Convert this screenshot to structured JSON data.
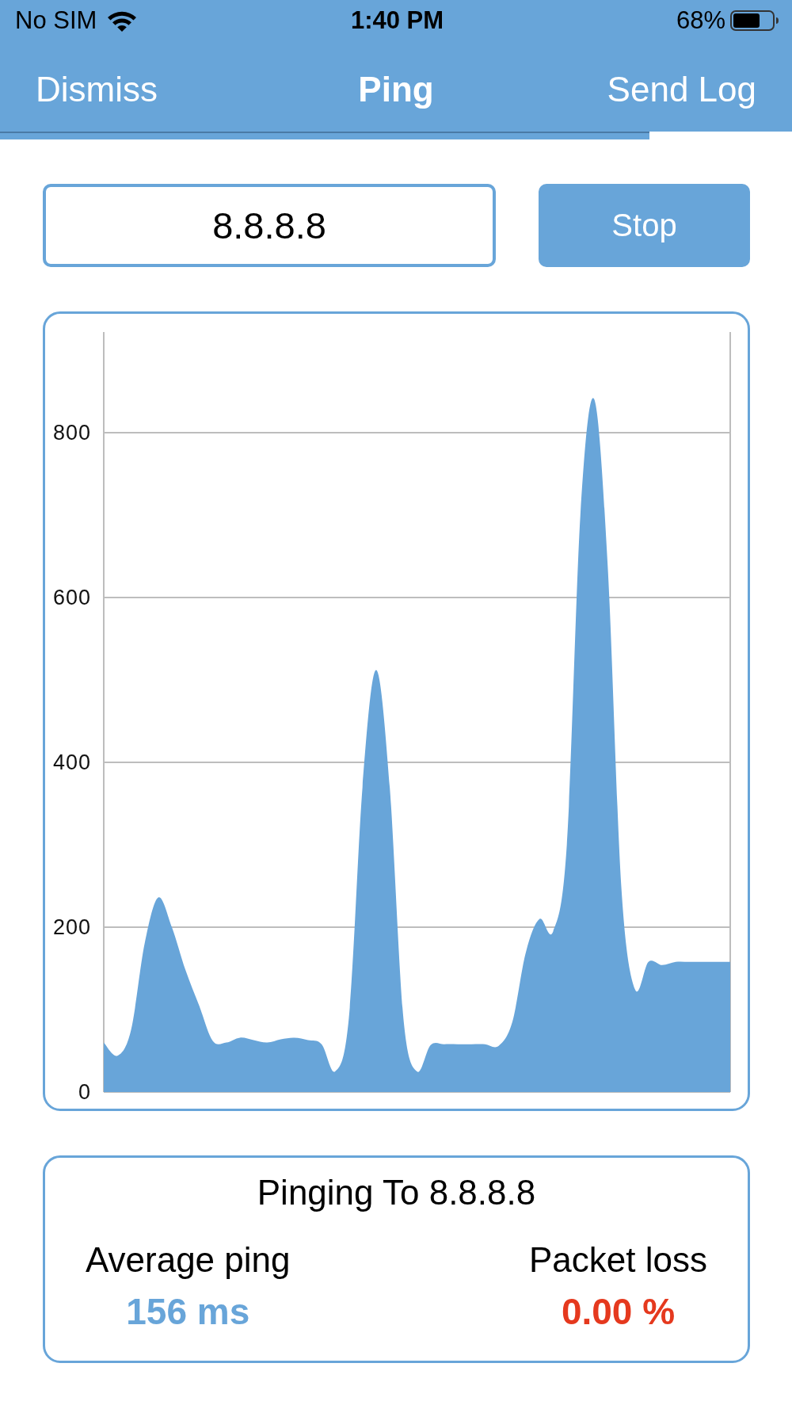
{
  "status_bar": {
    "carrier": "No SIM",
    "time": "1:40 PM",
    "battery": "68%"
  },
  "nav_bar": {
    "left_button": "Dismiss",
    "title": "Ping",
    "right_button": "Send Log"
  },
  "progress": {
    "level": 0.82
  },
  "host_field": {
    "value": "8.8.8.8"
  },
  "action_button": "Stop",
  "chart": {
    "chart_data": {
      "type": "area",
      "grid": true,
      "ylim": [
        0,
        922
      ],
      "yticks": [
        0,
        200,
        400,
        600,
        800
      ],
      "series": [
        {
          "color": "#68a5d9",
          "values": [
            60,
            44,
            75,
            180,
            236,
            200,
            148,
            105,
            62,
            60,
            66,
            63,
            60,
            64,
            66,
            63,
            58,
            25,
            90,
            370,
            512,
            370,
            90,
            25,
            57,
            58,
            58,
            58,
            58,
            56,
            85,
            170,
            210,
            195,
            300,
            700,
            841,
            640,
            250,
            125,
            158,
            154,
            158,
            158,
            158,
            158,
            158
          ]
        }
      ]
    }
  },
  "summary": {
    "title": "Pinging To 8.8.8.8",
    "stats": [
      {
        "label": "Average ping",
        "value": "156 ms",
        "color": "#68a5d9"
      },
      {
        "label": "Packet loss",
        "value": "0.00 %",
        "color": "#e5391e"
      }
    ]
  }
}
